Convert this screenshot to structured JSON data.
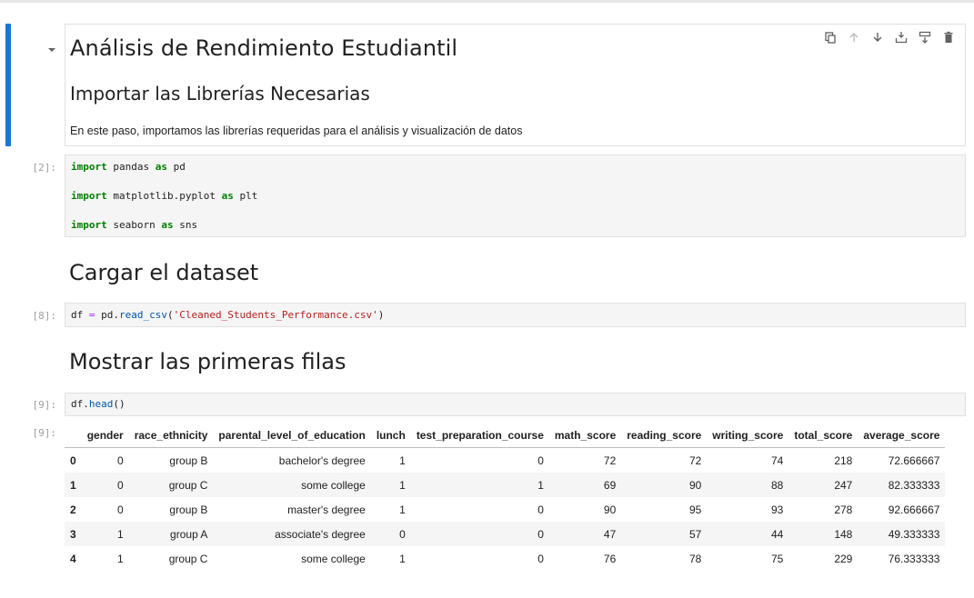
{
  "cells": {
    "markdown_1": {
      "h1": "Análisis de Rendimiento Estudiantil",
      "h2": "Importar las Librerías Necesarias",
      "paragraph": "En este paso, importamos las librerías requeridas para el análisis y visualización de datos"
    },
    "code_1": {
      "prompt": "[2]:",
      "lines": [
        {
          "kw1": "import",
          "mod": " pandas ",
          "kw2": "as",
          "alias": " pd"
        },
        {
          "kw1": "import",
          "mod": " matplotlib.pyplot ",
          "kw2": "as",
          "alias": " plt"
        },
        {
          "kw1": "import",
          "mod": " seaborn ",
          "kw2": "as",
          "alias": " sns"
        }
      ]
    },
    "markdown_2": {
      "heading": "Cargar el dataset"
    },
    "code_2": {
      "prompt": "[8]:",
      "var": "df",
      "eq": " = ",
      "obj": "pd.",
      "fn": "read_csv",
      "open": "(",
      "arg": "'Cleaned_Students_Performance.csv'",
      "close": ")"
    },
    "markdown_3": {
      "heading": "Mostrar las primeras filas"
    },
    "code_3": {
      "prompt": "[9]:",
      "var": "df.",
      "fn": "head",
      "call": "()"
    },
    "output_3": {
      "prompt": "[9]:",
      "columns": [
        "",
        "gender",
        "race_ethnicity",
        "parental_level_of_education",
        "lunch",
        "test_preparation_course",
        "math_score",
        "reading_score",
        "writing_score",
        "total_score",
        "average_score"
      ],
      "rows": [
        [
          "0",
          "0",
          "group B",
          "bachelor's degree",
          "1",
          "0",
          "72",
          "72",
          "74",
          "218",
          "72.666667"
        ],
        [
          "1",
          "0",
          "group C",
          "some college",
          "1",
          "1",
          "69",
          "90",
          "88",
          "247",
          "82.333333"
        ],
        [
          "2",
          "0",
          "group B",
          "master's degree",
          "1",
          "0",
          "90",
          "95",
          "93",
          "278",
          "92.666667"
        ],
        [
          "3",
          "1",
          "group A",
          "associate's degree",
          "0",
          "0",
          "47",
          "57",
          "44",
          "148",
          "49.333333"
        ],
        [
          "4",
          "1",
          "group C",
          "some college",
          "1",
          "0",
          "76",
          "78",
          "75",
          "229",
          "76.333333"
        ]
      ]
    }
  },
  "toolbar": {
    "icons": [
      "duplicate-icon",
      "move-up-icon",
      "move-down-icon",
      "insert-above-icon",
      "insert-below-icon",
      "delete-icon"
    ]
  },
  "colors": {
    "active_bar": "#1976d2",
    "keyword": "#008000",
    "string": "#ba2121",
    "function": "#0055aa",
    "prompt": "#9e9e9e"
  }
}
